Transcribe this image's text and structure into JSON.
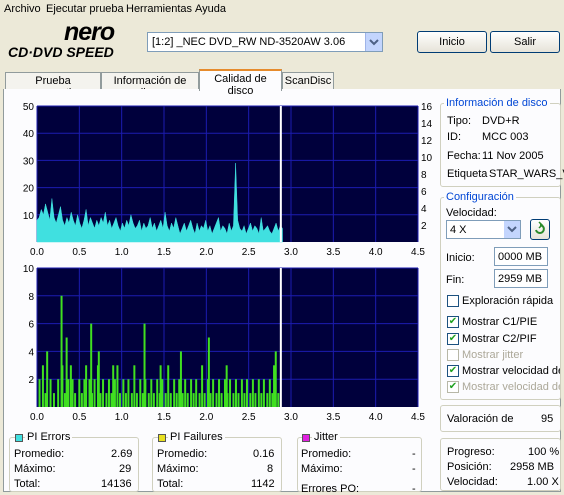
{
  "menu": [
    "Archivo",
    "Ejecutar prueba",
    "Herramientas",
    "Ayuda"
  ],
  "brand": {
    "top": "nero",
    "bottom": "CD·DVD SPEED"
  },
  "drive_select": {
    "value": "[1:2]  _NEC DVD_RW ND-3520AW 3.06"
  },
  "buttons": {
    "start": "Inicio",
    "exit": "Salir"
  },
  "tabs": [
    "Prueba comparativa",
    "Información de disco",
    "Calidad de disco",
    "ScanDisc"
  ],
  "disc_info": {
    "title": "Información de disco",
    "type_label": "Tipo:",
    "type_value": "DVD+R",
    "id_label": "ID:",
    "id_value": "MCC 003",
    "date_label": "Fecha:",
    "date_value": "11 Nov 2005",
    "tag_label": "Etiqueta",
    "tag_value": "STAR_WARS_V_"
  },
  "config": {
    "title": "Configuración",
    "speed_label": "Velocidad:",
    "speed_value": "4 X",
    "start_label": "Inicio:",
    "start_value": "0000 MB",
    "end_label": "Fin:",
    "end_value": "2959 MB",
    "quick_scan": "Exploración rápida",
    "show_c1": "Mostrar C1/PIE",
    "show_c2": "Mostrar C2/PIF",
    "show_jitter": "Mostrar jitter",
    "show_read_speed": "Mostrar velocidad de le",
    "show_write_speed": "Mostrar velocidad de e"
  },
  "rating": {
    "label": "Valoración de",
    "value": "95"
  },
  "progress": {
    "progress_label": "Progreso:",
    "progress_value": "100 %",
    "position_label": "Posición:",
    "position_value": "2958 MB",
    "speed_label": "Velocidad:",
    "speed_value": "1.00 X"
  },
  "pi_errors": {
    "title": "PI Errors",
    "color": "#40e0e0",
    "avg_label": "Promedio:",
    "avg": "2.69",
    "max_label": "Máximo:",
    "max": "29",
    "total_label": "Total:",
    "total": "14136"
  },
  "pi_failures": {
    "title": "PI Failures",
    "color": "#e8e020",
    "avg_label": "Promedio:",
    "avg": "0.16",
    "max_label": "Máximo:",
    "max": "8",
    "total_label": "Total:",
    "total": "1142"
  },
  "jitter": {
    "title": "Jitter",
    "color": "#e020e0",
    "avg_label": "Promedio:",
    "avg": "-",
    "max_label": "Máximo:",
    "max": "-",
    "po_label": "Errores PO:",
    "po": "-"
  },
  "chart_data": [
    {
      "type": "area",
      "series": [
        {
          "values": [
            8,
            9,
            12,
            10,
            14,
            11,
            8,
            16,
            9,
            7,
            10,
            13,
            8,
            6,
            9,
            7,
            11,
            8,
            6,
            10,
            7,
            5,
            8,
            12,
            6,
            9,
            7,
            5,
            8,
            6,
            9,
            7,
            11,
            6,
            8,
            5,
            7,
            9,
            6,
            4,
            7,
            5,
            8,
            6,
            10,
            7,
            5,
            6,
            8,
            4,
            7,
            5,
            6,
            9,
            5,
            7,
            4,
            6,
            8,
            5,
            11,
            6,
            4,
            7,
            5,
            9,
            6,
            3,
            5,
            7,
            4,
            6,
            8,
            5,
            3,
            7,
            4,
            6,
            5,
            8,
            4,
            6,
            3,
            5,
            7,
            9,
            4,
            6,
            5,
            3,
            7,
            4,
            6,
            29,
            8,
            5,
            4,
            6,
            3,
            5,
            7,
            4,
            6,
            5,
            3,
            9,
            4,
            5,
            6,
            4,
            3,
            5,
            7,
            4,
            6,
            5
          ]
        }
      ],
      "x_range": [
        0,
        2.9
      ],
      "xlim": [
        0,
        4.5
      ],
      "ylim": [
        0,
        50
      ],
      "y2lim": [
        0,
        16
      ],
      "xticks": [
        "0.0",
        "0.5",
        "1.0",
        "1.5",
        "2.0",
        "2.5",
        "3.0",
        "3.5",
        "4.0",
        "4.5"
      ],
      "yticks": [
        "10",
        "20",
        "30",
        "40",
        "50"
      ],
      "y2ticks": [
        "2",
        "4",
        "6",
        "8",
        "10",
        "12",
        "14",
        "16"
      ],
      "color": "#40e0e0",
      "cursor_x": 2.88
    },
    {
      "type": "bar",
      "spikes": [
        [
          0.03,
          2
        ],
        [
          0.07,
          3
        ],
        [
          0.1,
          1
        ],
        [
          0.12,
          4
        ],
        [
          0.16,
          2
        ],
        [
          0.2,
          1
        ],
        [
          0.25,
          2
        ],
        [
          0.3,
          3
        ],
        [
          0.33,
          1
        ],
        [
          0.37,
          2
        ],
        [
          0.4,
          3
        ],
        [
          0.42,
          2
        ],
        [
          0.45,
          1
        ],
        [
          0.5,
          2
        ],
        [
          0.53,
          1
        ],
        [
          0.56,
          2
        ],
        [
          0.58,
          3
        ],
        [
          0.62,
          2
        ],
        [
          0.65,
          1
        ],
        [
          0.68,
          2
        ],
        [
          0.72,
          3
        ],
        [
          0.75,
          1
        ],
        [
          0.78,
          2
        ],
        [
          0.82,
          1
        ],
        [
          0.85,
          2
        ],
        [
          0.88,
          1
        ],
        [
          0.92,
          2
        ],
        [
          0.95,
          3
        ],
        [
          0.98,
          1
        ],
        [
          1.02,
          2
        ],
        [
          1.05,
          1
        ],
        [
          1.08,
          2
        ],
        [
          1.12,
          1
        ],
        [
          1.15,
          3
        ],
        [
          1.18,
          1
        ],
        [
          1.22,
          2
        ],
        [
          1.25,
          1
        ],
        [
          1.28,
          2
        ],
        [
          1.32,
          1
        ],
        [
          1.35,
          2
        ],
        [
          1.38,
          1
        ],
        [
          1.42,
          2
        ],
        [
          1.45,
          1
        ],
        [
          1.48,
          2
        ],
        [
          1.52,
          1
        ],
        [
          1.55,
          3
        ],
        [
          1.58,
          1
        ],
        [
          1.62,
          2
        ],
        [
          1.65,
          1
        ],
        [
          1.68,
          2
        ],
        [
          1.72,
          1
        ],
        [
          1.75,
          2
        ],
        [
          1.78,
          1
        ],
        [
          1.82,
          2
        ],
        [
          1.85,
          1
        ],
        [
          1.88,
          2
        ],
        [
          1.92,
          1
        ],
        [
          1.95,
          3
        ],
        [
          1.98,
          1
        ],
        [
          2.02,
          2
        ],
        [
          2.05,
          1
        ],
        [
          2.08,
          2
        ],
        [
          2.12,
          1
        ],
        [
          2.15,
          2
        ],
        [
          2.18,
          1
        ],
        [
          2.22,
          2
        ],
        [
          2.25,
          1
        ],
        [
          2.28,
          2
        ],
        [
          2.32,
          1
        ],
        [
          2.35,
          2
        ],
        [
          2.38,
          1
        ],
        [
          2.42,
          2
        ],
        [
          2.45,
          1
        ],
        [
          2.48,
          2
        ],
        [
          2.52,
          1
        ],
        [
          2.55,
          2
        ],
        [
          2.58,
          1
        ],
        [
          2.62,
          2
        ],
        [
          2.65,
          1
        ],
        [
          2.68,
          2
        ],
        [
          2.72,
          1
        ],
        [
          2.75,
          2
        ],
        [
          2.78,
          1
        ],
        [
          2.82,
          4
        ],
        [
          2.85,
          1
        ],
        [
          0.29,
          8
        ],
        [
          0.35,
          5
        ],
        [
          0.64,
          6
        ],
        [
          0.73,
          4
        ],
        [
          0.9,
          3
        ],
        [
          1.27,
          6
        ],
        [
          1.46,
          3
        ],
        [
          1.7,
          4
        ],
        [
          2.03,
          5
        ],
        [
          2.24,
          3
        ],
        [
          2.8,
          3
        ]
      ],
      "xlim": [
        0,
        4.5
      ],
      "ylim": [
        0,
        10
      ],
      "xticks": [
        "0.0",
        "0.5",
        "1.0",
        "1.5",
        "2.0",
        "2.5",
        "3.0",
        "3.5",
        "4.0",
        "4.5"
      ],
      "yticks": [
        "2",
        "4",
        "6",
        "8",
        "10"
      ],
      "color": "#40e020",
      "cursor_x": 2.88
    }
  ]
}
